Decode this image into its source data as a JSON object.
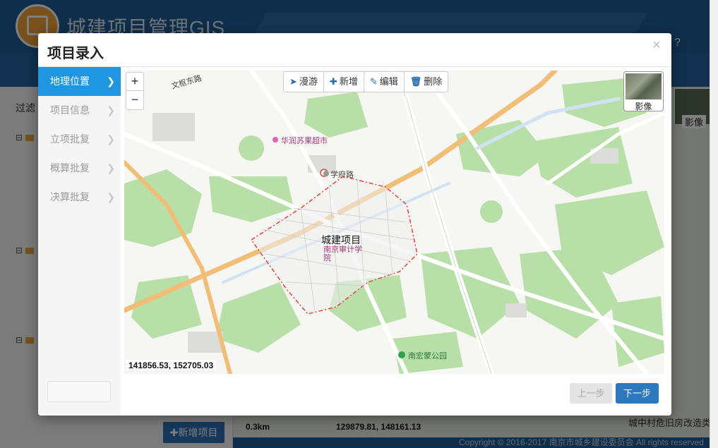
{
  "app": {
    "title": "城建项目管理GIS",
    "filter_label": "过滤",
    "new_project_button": "✚新增项目",
    "bg_scale": "0.3km",
    "bg_coordinates": "129879.81, 148161.13",
    "bg_basemap_label": "影像",
    "bg_layer_item": "城中村危旧房改造类",
    "footer": "Copyright © 2016-2017 南京市城乡建设委员会 All rights reserved"
  },
  "modal": {
    "title": "项目录入",
    "close": "×",
    "steps": [
      {
        "label": "地理位置",
        "active": true
      },
      {
        "label": "项目信息",
        "active": false
      },
      {
        "label": "立项批复",
        "active": false
      },
      {
        "label": "概算批复",
        "active": false
      },
      {
        "label": "决算批复",
        "active": false
      }
    ],
    "toolbar": {
      "pan": "漫游",
      "add": "新增",
      "edit": "编辑",
      "delete": "删除"
    },
    "zoom_in": "+",
    "zoom_out": "−",
    "basemap_label": "影像",
    "coordinates": "141856.53, 152705.03",
    "map_labels": {
      "road1": "文枢东路",
      "road2": "华润苏果超市",
      "road3": "学府路",
      "project": "城建项目",
      "school": "南京审计学院",
      "park": "南宏蒙公园"
    },
    "prev_button": "上一步",
    "next_button": "下一步"
  },
  "colors": {
    "accent": "#2196e0",
    "primary_button": "#2c78be",
    "header": "#1e5c96",
    "polygon": "#e0443c",
    "green": "#b8dfa6",
    "road": "#f5c27a"
  }
}
